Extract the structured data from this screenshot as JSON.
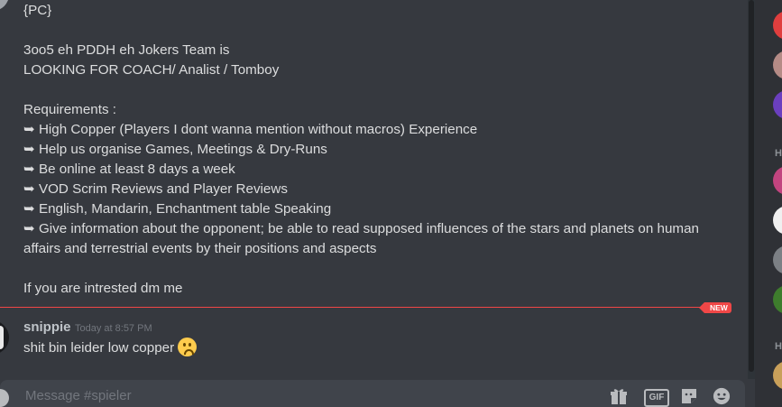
{
  "message": {
    "lines": [
      "{PC}",
      "",
      "3oo5 eh PDDH eh Jokers Team is",
      "LOOKING FOR COACH/ Analist / Tomboy",
      "",
      "Requirements :",
      "➥ High Copper (Players I dont wanna mention without macros) Experience",
      "➥ Help us organise Games, Meetings & Dry-Runs",
      "➥ Be online at least 8 days a week",
      "➥ VOD Scrim Reviews and Player Reviews",
      "➥ English, Mandarin, Enchantment table Speaking",
      "➥ Give information about the opponent; be able to read supposed influences of the stars and planets on human",
      "affairs and terrestrial events by their positions and aspects",
      "",
      "If you are intrested dm me"
    ]
  },
  "divider": {
    "badge": "NEW"
  },
  "reply": {
    "author": "snippie",
    "timestamp": "Today at 8:57 PM",
    "text": "shit bin leider low copper",
    "emoji": "frowning-face"
  },
  "composer": {
    "placeholder": "Message #spieler"
  },
  "toolbar": {
    "gif_label": "GIF"
  },
  "members": {
    "headers": [
      "H",
      "H"
    ]
  },
  "colors": {
    "background": "#36393f",
    "new_divider": "#f04747",
    "composer_bg": "#40444b",
    "sidebar_bg": "#2f3136"
  }
}
